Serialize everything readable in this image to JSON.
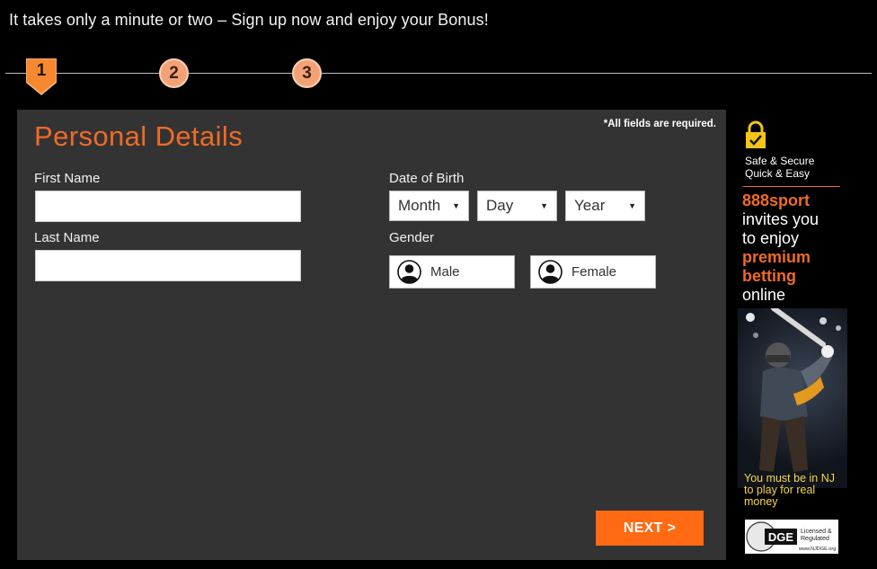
{
  "header": {
    "tagline": "It takes only a minute or two – Sign up now and enjoy your Bonus!"
  },
  "stepper": {
    "steps": [
      "1",
      "2",
      "3"
    ],
    "active_step": 1
  },
  "form": {
    "title": "Personal Details",
    "required_note": "*All fields are required.",
    "first_name": {
      "label": "First Name",
      "value": "",
      "placeholder": ""
    },
    "last_name": {
      "label": "Last Name",
      "value": "",
      "placeholder": ""
    },
    "dob": {
      "label": "Date of Birth",
      "month": "Month",
      "day": "Day",
      "year": "Year"
    },
    "gender": {
      "label": "Gender",
      "male": "Male",
      "female": "Female"
    },
    "next_label": "NEXT >"
  },
  "sidebar": {
    "secure_line1": "Safe & Secure",
    "secure_line2": "Quick & Easy",
    "brand": "888sport",
    "line_invites": "invites you",
    "line_to_enjoy": "to enjoy",
    "line_premium": "premium",
    "line_betting": "betting",
    "line_online": "online",
    "nj_notice": "You must be in NJ to play for real money",
    "badge_logo": "DGE",
    "badge_text1": "Licensed &",
    "badge_text2": "Regulated",
    "badge_url": "www.NJDGE.org"
  },
  "colors": {
    "accent": "#ef6b26",
    "button": "#ff6a13",
    "panel": "#333333",
    "step_inactive": "#f3a276",
    "notice": "#f7d84a"
  },
  "icons": {
    "lock": "lock-icon",
    "avatar": "user-avatar-icon",
    "caret": "caret-down-icon"
  }
}
